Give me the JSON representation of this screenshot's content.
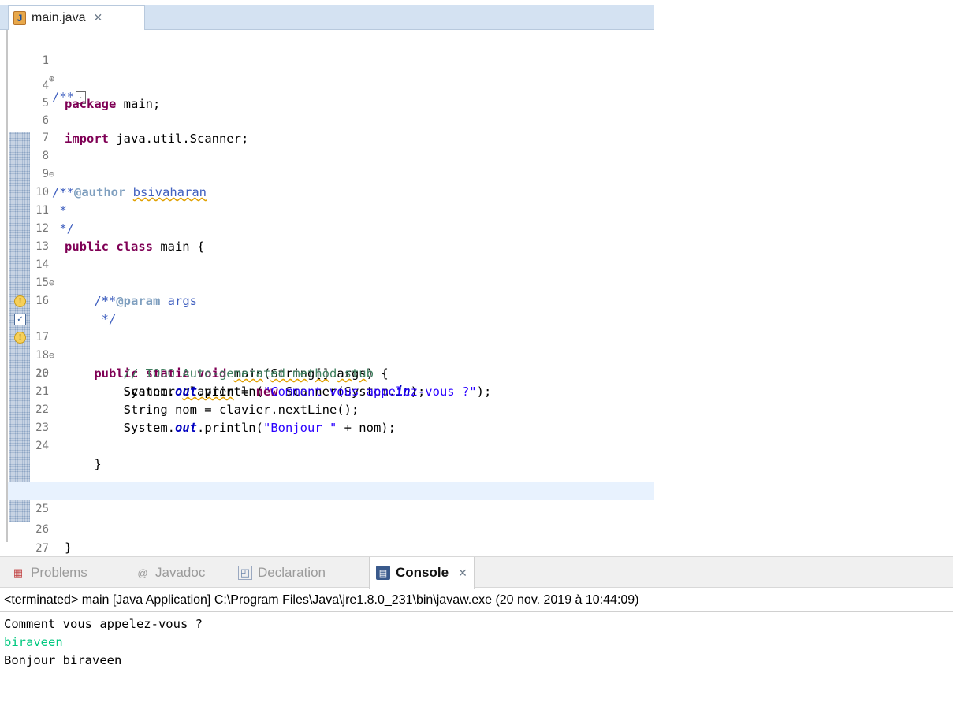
{
  "editor": {
    "tab_title": "main.java",
    "tab_close": "✕",
    "file_icon_letter": "J",
    "lines": {
      "l1": {
        "num": "1",
        "fold": "⊕",
        "code": "/**"
      },
      "l4": {
        "num": "4",
        "k": "package",
        "t": " main;"
      },
      "l5": {
        "num": "5"
      },
      "l6": {
        "num": "6",
        "k": "import",
        "t": " java.util.Scanner;"
      },
      "l7": {
        "num": "7"
      },
      "l8": {
        "num": "8",
        "fold": "⊖",
        "t": "/**"
      },
      "l9": {
        "num": "9",
        "t1": " * ",
        "tag": "@author",
        "sp": " ",
        "w": "bsivaharan"
      },
      "l10": {
        "num": "10",
        "t": " *"
      },
      "l11": {
        "num": "11",
        "t": " */"
      },
      "l12": {
        "num": "12",
        "k": "public class",
        "t": " main {"
      },
      "l13": {
        "num": "13"
      },
      "l14": {
        "num": "14",
        "fold": "⊖",
        "t": "    /**"
      },
      "l15": {
        "num": "15",
        "t1": "     * ",
        "tag": "@param",
        "t2": " args"
      },
      "l16": {
        "num": "16",
        "t": "     */"
      },
      "l17": {
        "num": "17",
        "fold": "⊖",
        "k": "    public static void",
        "t1": " ",
        "m": "main",
        "t2": "(",
        "s": "String[]",
        "t3": " ",
        "a": "args",
        "t4": ") {"
      },
      "l18": {
        "num": "18",
        "c": "        // TODO Auto-generated method stub"
      },
      "l19": {
        "num": "19",
        "t1": "        Scanner ",
        "w": "clavier",
        "t2": " = ",
        "k": "new",
        "t3": " Scanner(System.",
        "f": "in",
        "t4": ");"
      },
      "l20": {
        "num": "20",
        "t1": "        System.",
        "f": "out",
        "t2": ".println(",
        "s": "\"Comment vous appelez-vous ?\"",
        "t3": ");"
      },
      "l21": {
        "num": "21",
        "t": "        String nom = clavier.nextLine();"
      },
      "l22": {
        "num": "22",
        "t1": "        System.",
        "f": "out",
        "t2": ".println(",
        "s": "\"Bonjour \"",
        "t3": " + nom);"
      },
      "l23": {
        "num": "23"
      },
      "l24": {
        "num": "24",
        "t": "    }"
      },
      "l25": {
        "num": "25"
      },
      "l26": {
        "num": "26",
        "t": "}"
      },
      "l27": {
        "num": "27"
      }
    }
  },
  "console": {
    "tabs": {
      "problems": "Problems",
      "javadoc": "Javadoc",
      "declaration": "Declaration",
      "console": "Console"
    },
    "tab_close": "✕",
    "terminated_info": "<terminated> main [Java Application] C:\\Program Files\\Java\\jre1.8.0_231\\bin\\javaw.exe (20 nov. 2019 à 10:44:09)",
    "output": {
      "line1": "Comment vous appelez-vous ?",
      "line2": "biraveen",
      "line3": "Bonjour biraveen"
    }
  }
}
